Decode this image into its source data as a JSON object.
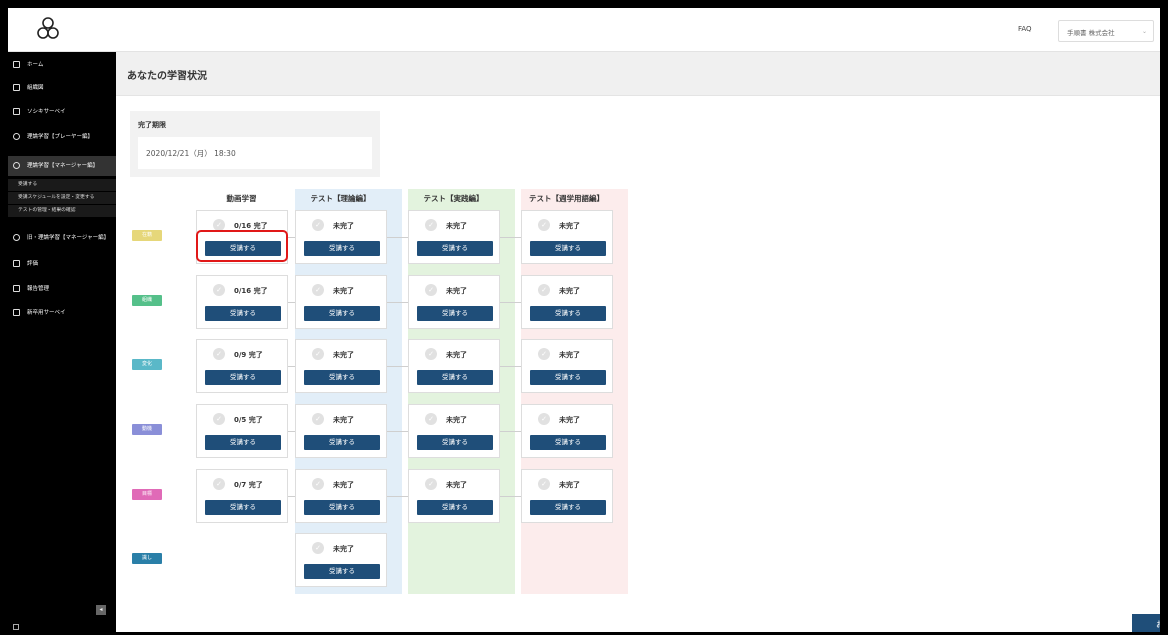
{
  "header": {
    "faq_label": "FAQ",
    "company_name": "手順書 株式会社",
    "company_chevron": "⌄"
  },
  "sidebar": {
    "items": [
      {
        "label": "ホーム"
      },
      {
        "label": "組織図"
      },
      {
        "label": "ソシキサーベイ"
      },
      {
        "label": "理論学習【プレーヤー編】"
      },
      {
        "label": "理論学習【マネージャー編】"
      },
      {
        "label": "旧・理論学習【マネージャー編】"
      },
      {
        "label": "評価"
      },
      {
        "label": "報告管理"
      },
      {
        "label": "新卒用サーベイ"
      }
    ],
    "subitems": [
      {
        "label": "受講する"
      },
      {
        "label": "受講スケジュールを設定・変更する"
      },
      {
        "label": "テストの管理・結果の確認"
      }
    ],
    "collapse_icon": "◂"
  },
  "main": {
    "title": "あなたの学習状況",
    "deadline_label": "完了期限",
    "deadline_value": "2020/12/21（月） 18:30",
    "columns": [
      {
        "label": "動画学習",
        "color": "#ffffff"
      },
      {
        "label": "テスト【理論編】",
        "color": "#e2eef8"
      },
      {
        "label": "テスト【実践編】",
        "color": "#e3f3de"
      },
      {
        "label": "テスト【週学用語編】",
        "color": "#fcecec"
      }
    ],
    "rows": [
      {
        "badge": "在籍",
        "badge_color": "#e6d77a",
        "video_status": "0/16 完了"
      },
      {
        "badge": "組織",
        "badge_color": "#55c08a",
        "video_status": "0/16 完了"
      },
      {
        "badge": "変化",
        "badge_color": "#5ab8c8",
        "video_status": "0/9 完了"
      },
      {
        "badge": "動機",
        "badge_color": "#8a8fd8",
        "video_status": "0/5 完了"
      },
      {
        "badge": "目標",
        "badge_color": "#e06ab7",
        "video_status": "0/7 完了"
      },
      {
        "badge": "識し",
        "badge_color": "#2a7fa8"
      }
    ],
    "incomplete_label": "未完了",
    "attend_button_label": "受講する",
    "check_icon": "✓",
    "cta_label": "お"
  },
  "colors": {
    "button": "#1f4e79",
    "highlight": "#e11818"
  }
}
